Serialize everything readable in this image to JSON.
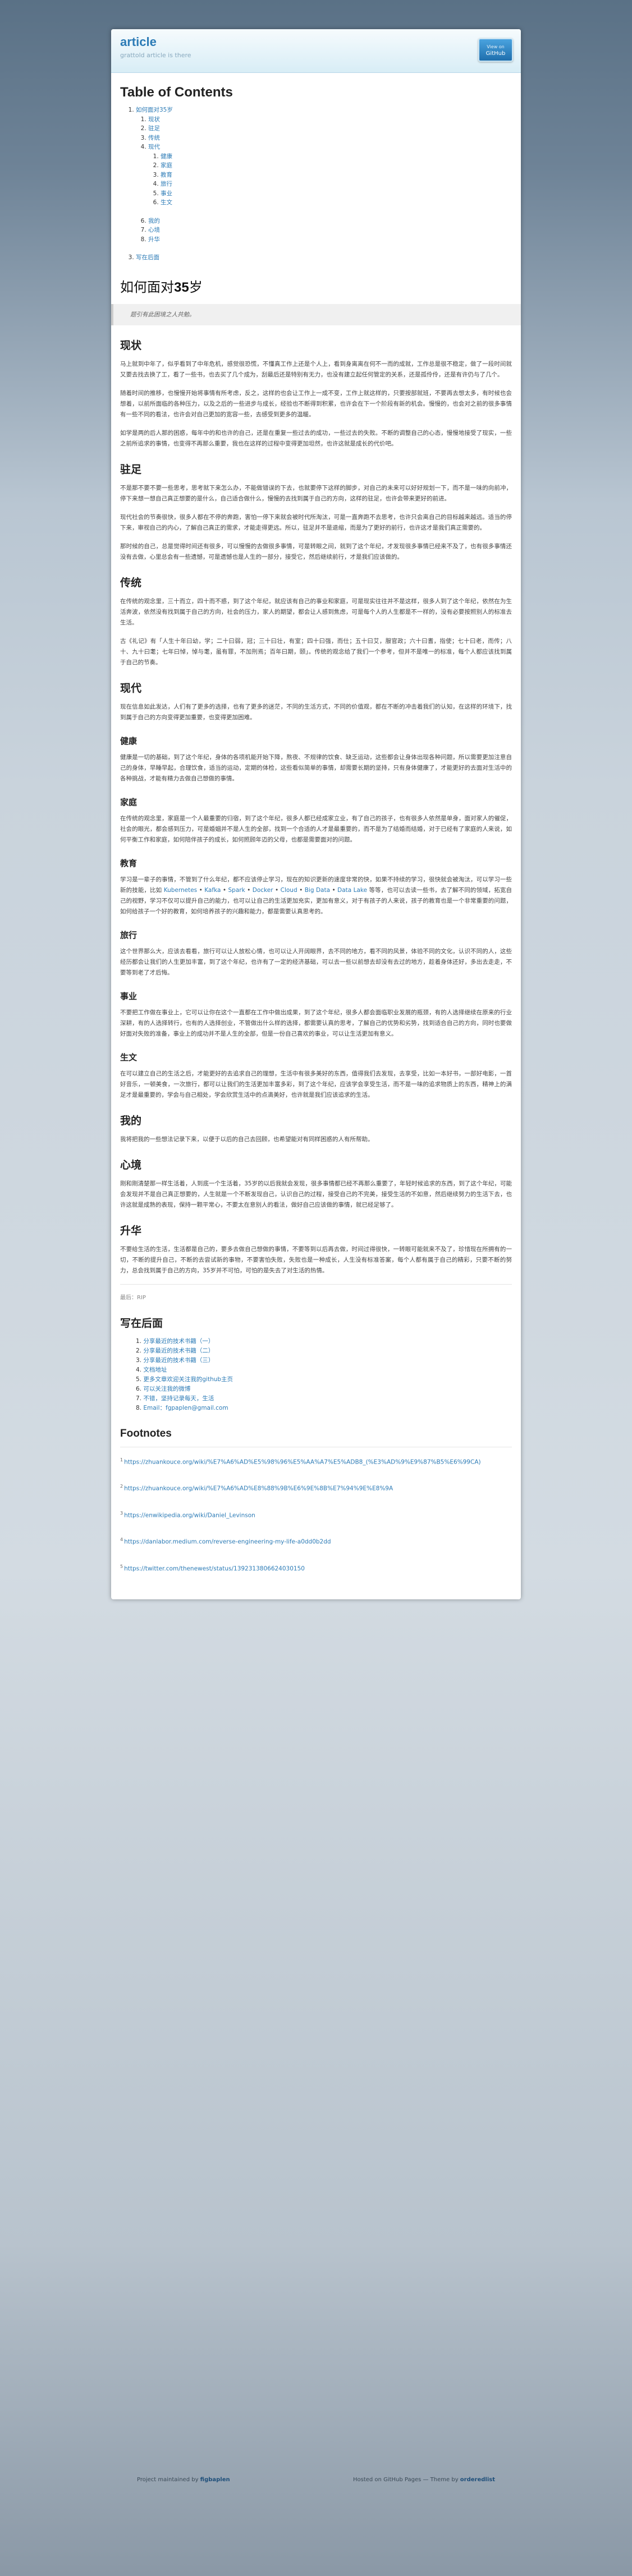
{
  "header": {
    "title": "article",
    "tagline": "grattold article is there",
    "github_label": "GitHub",
    "github_sub": "View on"
  },
  "toc": {
    "title": "Table of Contents",
    "item1": "如何面对35岁",
    "sub": [
      "现状",
      "驻足",
      "传统",
      "现代"
    ],
    "subsub": [
      "健康",
      "家庭",
      "教育",
      "旅行",
      "事业",
      "生文"
    ],
    "sub2": [
      "我的",
      "心境",
      "升华"
    ],
    "item2": "写在后面"
  },
  "post": {
    "title_pre": "如何面对",
    "title_num": "35",
    "title_post": "岁",
    "quote": "题引有此困境之人共勉。",
    "sections": {
      "s1": {
        "h": "现状",
        "p": [
          "马上就到中年了，似乎看到了中年危机，感觉很恐慌，不懂真工作上还是个人上，看到身离离在何不一而的成就，工作总是很不稳定，做了一段时间就又要去找去换了工，看了一些书，也去买了几个成为，刮最后还是特别有无力，也没有建立起任何管定的关系，还是孤伶伶，还是有许仍与了几个。",
          "随着时间的推移，也慢慢开始将事情有所考虑，反之，这样的也会让工作上一成不变，工作上就这样的，只要按部就班，不要再去想太多，有时候也会想着，以前所面临的各种压力，以及之后的一些进步与成长，经验也不断得到积累，也许会在下一个阶段有新的机会。慢慢的，也会对之前的很多事情有一些不同的看法，也许会对自己更加的宽容一些，去感受到更多的温暖。",
          "如学是两的后人那的困惑，每年中的和也许的自己，还是在重复一些过去的成功，一些过去的失败。不断的调整自己的心态，慢慢地接受了现实，一些之前所追求的事情，也变得不再那么重要，我也在这样的过程中变得更加坦然，也许这就是成长的代价吧。"
        ]
      },
      "s2": {
        "h": "驻足",
        "p": [
          "不是那不要不要一些思考，思考就下来怎么办，不能做错误的下去，也就要停下这样的脚步，对自己的未来可以好好规划一下，而不是一味的向前冲，停下来想一想自己真正想要的是什么，自己适合做什么，慢慢的去找到属于自己的方向，这样的驻足，也许会带来更好的前进。",
          "现代社会的节奏很快，很多人都在不停的奔跑，害怕一停下来就会被时代所淘汰，可是一直奔跑不去思考，也许只会离自己的目标越来越远。适当的停下来，审视自己的内心，了解自己真正的需求，才能走得更远。所以，驻足并不是退缩，而是为了更好的前行，也许这才是我们真正需要的。",
          "那时候的自己，总是觉得时间还有很多，可以慢慢的去做很多事情，可是转眼之间，就到了这个年纪，才发现很多事情已经来不及了，也有很多事情还没有去做，心里总会有一些遗憾，可是遗憾也是人生的一部分，接受它，然后继续前行，才是我们应该做的。"
        ]
      },
      "s3": {
        "h": "传统",
        "p": [
          "在传统的观念里，三十而立，四十而不惑，到了这个年纪，就应该有自己的事业和家庭，可是现实往往并不是这样，很多人到了这个年纪，依然在为生活奔波，依然没有找到属于自己的方向，社会的压力，家人的期望，都会让人感到焦虑，可是每个人的人生都是不一样的，没有必要按照别人的标准去生活。",
          "古《礼记》有「人生十年曰幼，学；二十曰弱，冠；三十曰壮，有室；四十曰强，而仕；五十曰艾，服官政；六十曰耆，指使；七十曰老，而传；八十、九十曰耄；七年曰悼，悼与耄，虽有罪，不加刑焉；百年曰期，颐」。传统的观念给了我们一个参考，但并不是唯一的标准，每个人都应该找到属于自己的节奏。"
        ]
      },
      "s4": {
        "h": "现代",
        "p": [
          "现在信息如此发达，人们有了更多的选择，也有了更多的迷茫，不同的生活方式，不同的价值观，都在不断的冲击着我们的认知，在这样的环境下，找到属于自己的方向变得更加重要，也变得更加困难。"
        ],
        "subs": [
          {
            "h": "健康",
            "p": "健康是一切的基础，到了这个年纪，身体的各项机能开始下降，熬夜、不规律的饮食、缺乏运动，这些都会让身体出现各种问题，所以需要更加注意自己的身体，早睡早起，合理饮食，适当的运动，定期的体检，这些看似简单的事情，却需要长期的坚持，只有身体健康了，才能更好的去面对生活中的各种挑战，才能有精力去做自己想做的事情。"
          },
          {
            "h": "家庭",
            "p": "在传统的观念里，家庭是一个人最重要的归宿，到了这个年纪，很多人都已经成家立业，有了自己的孩子，也有很多人依然是单身，面对家人的催促，社会的眼光，都会感到压力，可是婚姻并不是人生的全部，找到一个合适的人才是最重要的，而不是为了结婚而结婚，对于已经有了家庭的人来说，如何平衡工作和家庭，如何陪伴孩子的成长，如何照顾年迈的父母，也都是需要面对的问题。"
          },
          {
            "h": "教育",
            "p_pre": "学习是一辈子的事情，不管到了什么年纪，都不应该停止学习，现在的知识更新的速度非常的快，如果不持续的学习，很快就会被淘汰，可以学习一些新的技能，比如 ",
            "links": [
              "Kubernetes",
              "Kafka",
              "Spark",
              "Docker",
              "Cloud",
              "Big Data",
              "Data Lake"
            ],
            "p_post": " 等等，也可以去读一些书，去了解不同的领域，拓宽自己的视野，学习不仅可以提升自己的能力，也可以让自己的生活更加充实，更加有意义，对于有孩子的人来说，孩子的教育也是一个非常重要的问题，如何给孩子一个好的教育，如何培养孩子的兴趣和能力，都是需要认真思考的。"
          },
          {
            "h": "旅行",
            "p": "这个世界那么大，应该去看看，旅行可以让人放松心情，也可以让人开阔眼界，去不同的地方，看不同的风景，体验不同的文化，认识不同的人，这些经历都会让我们的人生更加丰富，到了这个年纪，也许有了一定的经济基础，可以去一些以前想去却没有去过的地方，趁着身体还好，多出去走走，不要等到老了才后悔。"
          },
          {
            "h": "事业",
            "p": "不要把工作做在事业上，它可以让你在这个一直都在工作中做出成果，到了这个年纪，很多人都会面临职业发展的瓶颈，有的人选择继续在原来的行业深耕，有的人选择转行，也有的人选择创业，不管做出什么样的选择，都需要认真的思考，了解自己的优势和劣势，找到适合自己的方向，同时也要做好面对失败的准备，事业上的成功并不是人生的全部，但是一份自己喜欢的事业，可以让生活更加有意义。"
          },
          {
            "h": "生文",
            "p": "在可以建立自己的生活之后，才能更好的去追求自己的理想，生活中有很多美好的东西，值得我们去发现，去享受，比如一本好书，一部好电影，一首好音乐，一顿美食，一次旅行，都可以让我们的生活更加丰富多彩，到了这个年纪，应该学会享受生活，而不是一味的追求物质上的东西，精神上的满足才是最重要的，学会与自己相处，学会欣赏生活中的点滴美好，也许就是我们应该追求的生活。"
          }
        ]
      },
      "s5": {
        "h": "我的",
        "p": "我将把我的一些想法记录下来，以便于以后的自己去回顾，也希望能对有同样困惑的人有所帮助。"
      },
      "s6": {
        "h": "心境",
        "p": "刚和刚清楚那一样生活着，人到底一个生活着，35岁的以后我就会发现，很多事情都已经不再那么重要了，年轻时候追求的东西，到了这个年纪，可能会发现并不是自己真正想要的，人生就是一个不断发现自己，认识自己的过程，接受自己的不完美，接受生活的不如意，然后继续努力的生活下去，也许这就是成熟的表现，保持一颗平常心，不要太在意别人的看法，做好自己应该做的事情，就已经足够了。"
      },
      "s7": {
        "h": "升华",
        "p": "不要给生活的生活，生活都是自己的，要多去做自己想做的事情，不要等到以后再去做，时间过得很快，一转眼可能就来不及了，珍惜现在所拥有的一切，不断的提升自己，不断的去尝试新的事物，不要害怕失败，失败也是一种成长，人生没有标准答案，每个人都有属于自己的精彩，只要不断的努力，总会找到属于自己的方向，35岁并不可怕，可怕的是失去了对生活的热情。"
      }
    },
    "end": "最后：RIP"
  },
  "after": {
    "h": "写在后面",
    "items": [
      "分享最近的技术书籍（一）",
      "分享最近的技术书籍（二）",
      "分享最近的技术书籍（三）",
      "文档地址",
      "更多文章欢迎关注我的github主页",
      "可以关注我的微博",
      "不错，坚持记录每天，生活",
      "Email：fgpaplen@gmail.com"
    ],
    "labels": [
      "1.",
      "2.",
      "3.",
      "4.",
      "5.",
      "6.",
      "7.",
      "8."
    ]
  },
  "footnotes": {
    "h": "Footnotes",
    "items": [
      "https://zhuankouce.org/wiki/%E7%A6%AD%E5%98%96%E5%AA%A7%E5%ADB8_(%E3%AD%9%E9%87%B5%E6%99CA)",
      "https://zhuankouce.org/wiki/%E7%A6%AD%E8%88%9B%E6%9E%8B%E7%94%9E%E8%9A",
      "https://enwikipedia.org/wiki/Daniel_Levinson",
      "https://danlabor.medium.com/reverse-engineering-my-life-a0dd0b2dd",
      "https://twitter.com/thenewest/status/1392313806624030150"
    ],
    "nums": [
      "1",
      "2",
      "3",
      "4",
      "5"
    ]
  },
  "footer": {
    "left_pre": "Project maintained by ",
    "left_name": "figbaplen",
    "right_pre": "Hosted on GitHub Pages — Theme by ",
    "right_name": "orderedlist"
  }
}
